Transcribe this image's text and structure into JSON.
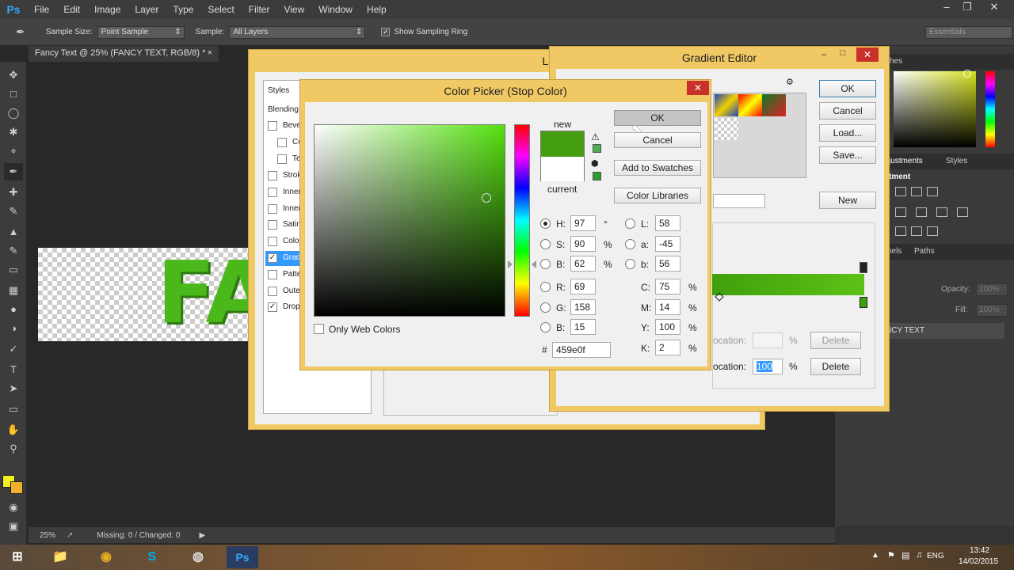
{
  "app": {
    "logo": "Ps"
  },
  "menu": [
    "File",
    "Edit",
    "Image",
    "Layer",
    "Type",
    "Select",
    "Filter",
    "View",
    "Window",
    "Help"
  ],
  "options": {
    "sample_size_label": "Sample Size:",
    "sample_size_value": "Point Sample",
    "sample_label": "Sample:",
    "sample_value": "All Layers",
    "show_ring_label": "Show Sampling Ring",
    "workspace": "Essentials"
  },
  "document": {
    "tab": "Fancy Text @ 25% (FANCY TEXT, RGB/8) *",
    "canvas_text": "FA",
    "zoom": "25%",
    "status": "Missing: 0 / Changed: 0"
  },
  "panels": {
    "swatches_tab": "ches",
    "adjustments_tab": "justments",
    "styles_tab": "Styles",
    "adjust_label": "tment",
    "channels_tab": "nels",
    "paths_tab": "Paths",
    "opacity_label": "Opacity:",
    "opacity_value": "100%",
    "fill_label": "Fill:",
    "fill_value": "100%",
    "layer_name": "NCY TEXT"
  },
  "layer_style": {
    "title": "Layer Style",
    "styles_header": "Styles",
    "blending": "Blending",
    "items": [
      {
        "label": "Bevel",
        "checked": false
      },
      {
        "label": "Co",
        "checked": false
      },
      {
        "label": "Te",
        "checked": false
      },
      {
        "label": "Strok",
        "checked": false
      },
      {
        "label": "Inner",
        "checked": false
      },
      {
        "label": "Inner",
        "checked": false
      },
      {
        "label": "Satin",
        "checked": false
      },
      {
        "label": "Color",
        "checked": false
      },
      {
        "label": "Gradi",
        "checked": true
      },
      {
        "label": "Patte",
        "checked": false
      },
      {
        "label": "Outer",
        "checked": false
      },
      {
        "label": "Drop",
        "checked": true
      }
    ]
  },
  "gradient_editor": {
    "title": "Gradient Editor",
    "ok": "OK",
    "cancel": "Cancel",
    "load": "Load...",
    "save": "Save...",
    "new": "New",
    "location_label": "ocation:",
    "location_value": "100",
    "pct": "%",
    "delete": "Delete"
  },
  "color_picker": {
    "title": "Color Picker (Stop Color)",
    "new_label": "new",
    "current_label": "current",
    "new_color": "#459e0f",
    "current_color": "#ffffff",
    "ok": "OK",
    "cancel": "Cancel",
    "add_swatches": "Add to Swatches",
    "color_libraries": "Color Libraries",
    "only_web": "Only Web Colors",
    "hsb": {
      "H": "97",
      "S": "90",
      "B": "62"
    },
    "rgb": {
      "R": "69",
      "G": "158",
      "B": "15"
    },
    "lab": {
      "L": "58",
      "a": "-45",
      "b": "56"
    },
    "cmyk": {
      "C": "75",
      "M": "14",
      "Y": "100",
      "K": "2"
    },
    "units": {
      "deg": "°",
      "pct": "%"
    },
    "hex_label": "#",
    "hex": "459e0f"
  },
  "taskbar": {
    "lang": "ENG",
    "time": "13:42",
    "date": "14/02/2015"
  }
}
